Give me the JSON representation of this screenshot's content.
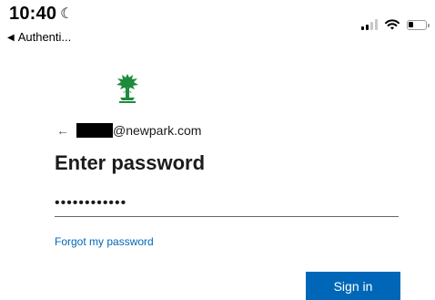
{
  "status_bar": {
    "time": "10:40",
    "back_app_label": "Authenti...",
    "icons": [
      "moon-icon",
      "signal-icon",
      "wifi-icon",
      "battery-icon"
    ]
  },
  "brand": {
    "logo": "tree-logo-icon",
    "logo_color": "#1e8a3c"
  },
  "identity": {
    "back_icon": "left-arrow-icon",
    "email_domain": "@newpark.com"
  },
  "page": {
    "title": "Enter password"
  },
  "password": {
    "value": "••••••••••••"
  },
  "links": {
    "forgot_password": "Forgot my password"
  },
  "buttons": {
    "sign_in": "Sign in"
  },
  "colors": {
    "accent": "#0067b8",
    "text": "#1b1b1b"
  }
}
